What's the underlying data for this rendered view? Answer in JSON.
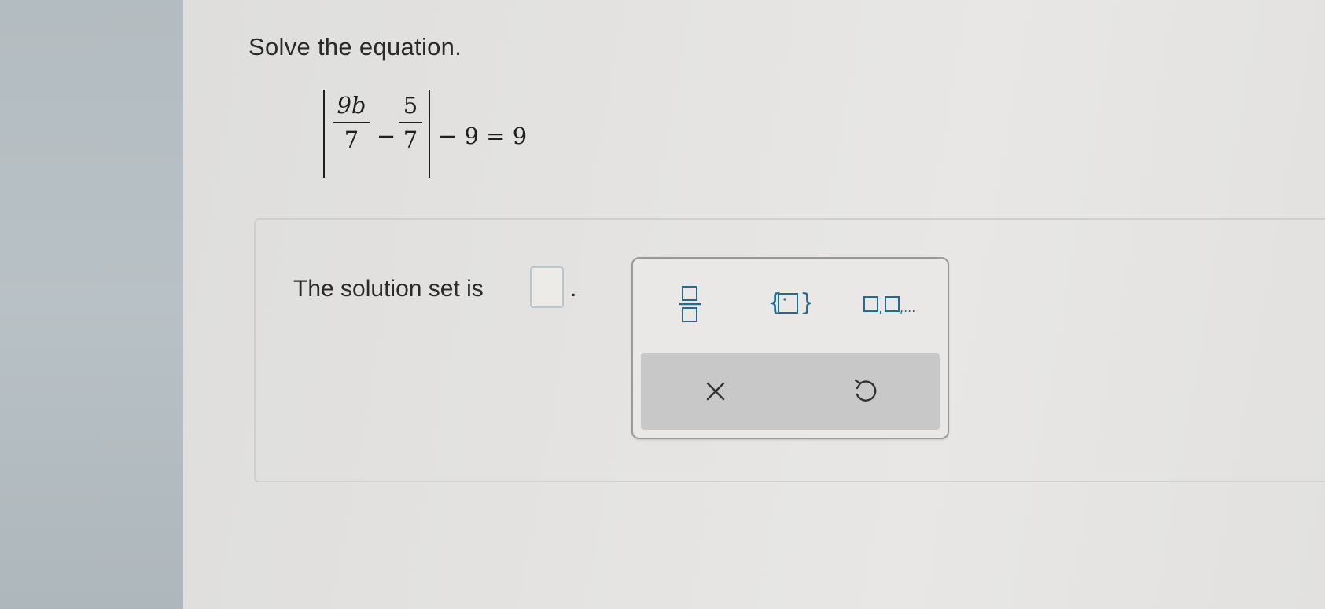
{
  "question": {
    "prompt": "Solve the equation.",
    "equation": {
      "frac1_num": "9b",
      "frac1_den": "7",
      "minus": "−",
      "frac2_num": "5",
      "frac2_den": "7",
      "tail": "− 9 = 9"
    }
  },
  "answer": {
    "label": "The solution set is",
    "period": ".",
    "value": ""
  },
  "palette": {
    "tools": [
      {
        "name": "fraction",
        "icon": "fraction-icon"
      },
      {
        "name": "set-braces",
        "icon": "set-braces-icon"
      },
      {
        "name": "list",
        "icon": "list-icon",
        "text": "□,□,..."
      }
    ],
    "actions": [
      {
        "name": "clear",
        "icon": "close-icon"
      },
      {
        "name": "undo",
        "icon": "undo-icon"
      }
    ]
  },
  "colors": {
    "tool_accent": "#1f6d93",
    "bezel": "#b3bcc0"
  }
}
